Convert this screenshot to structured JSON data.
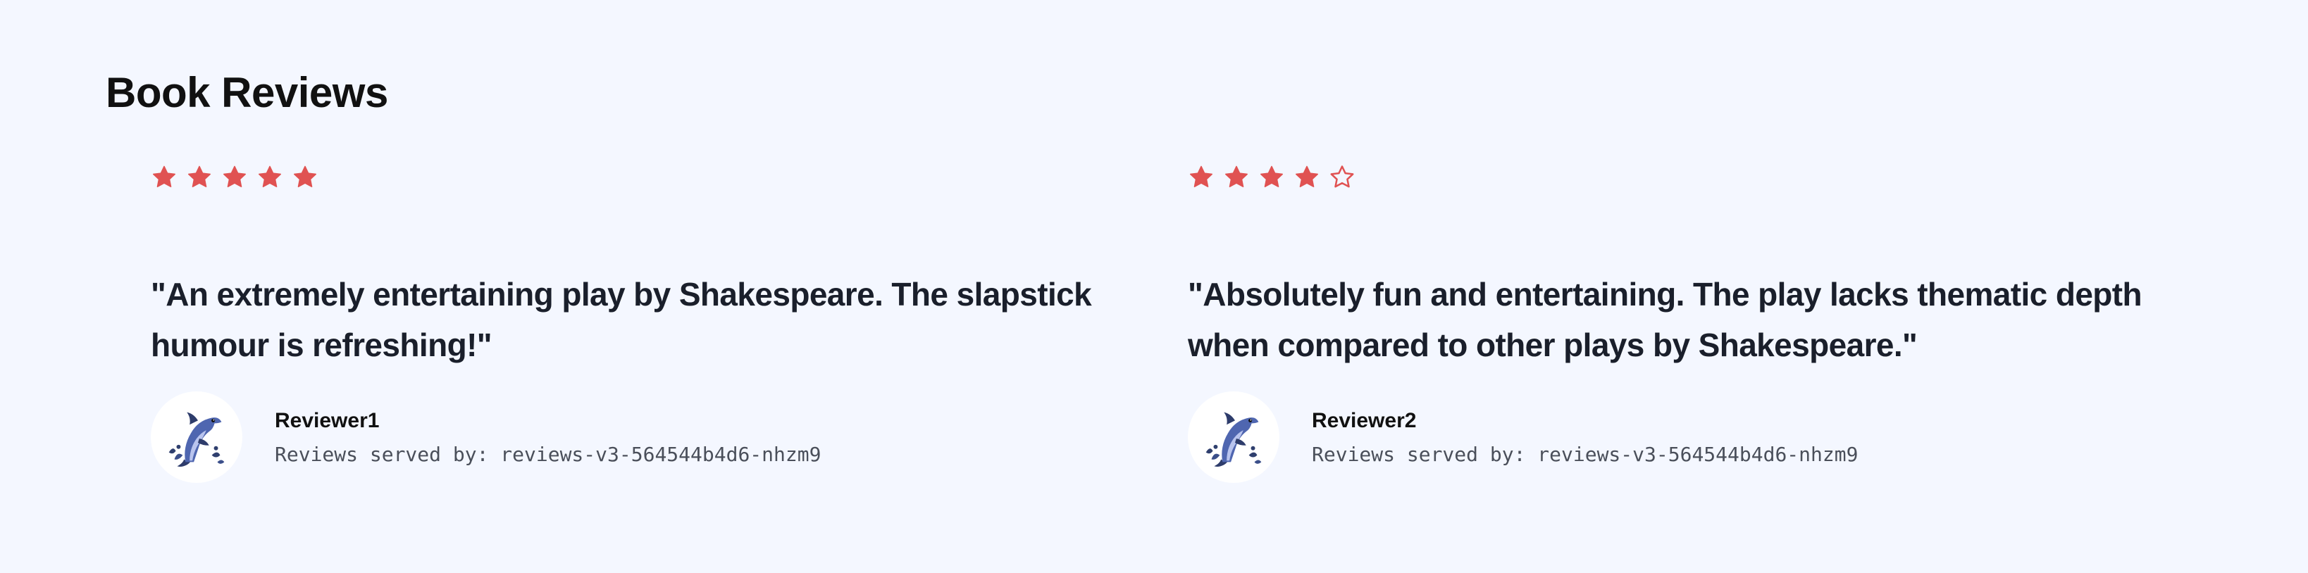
{
  "page": {
    "title": "Book Reviews"
  },
  "colors": {
    "background": "#f4f7ff",
    "star": "#e05252",
    "quote_text": "#1a1f2b"
  },
  "reviews": [
    {
      "rating": 5,
      "max_rating": 5,
      "text": "\"An extremely entertaining play by Shakespeare. The slapstick humour is refreshing!\"",
      "reviewer": "Reviewer1",
      "served_by": "Reviews served by: reviews-v3-564544b4d6-nhzm9",
      "avatar_icon": "dolphin-icon"
    },
    {
      "rating": 4,
      "max_rating": 5,
      "text": "\"Absolutely fun and entertaining. The play lacks thematic depth when compared to other plays by Shakespeare.\"",
      "reviewer": "Reviewer2",
      "served_by": "Reviews served by: reviews-v3-564544b4d6-nhzm9",
      "avatar_icon": "dolphin-icon"
    }
  ]
}
